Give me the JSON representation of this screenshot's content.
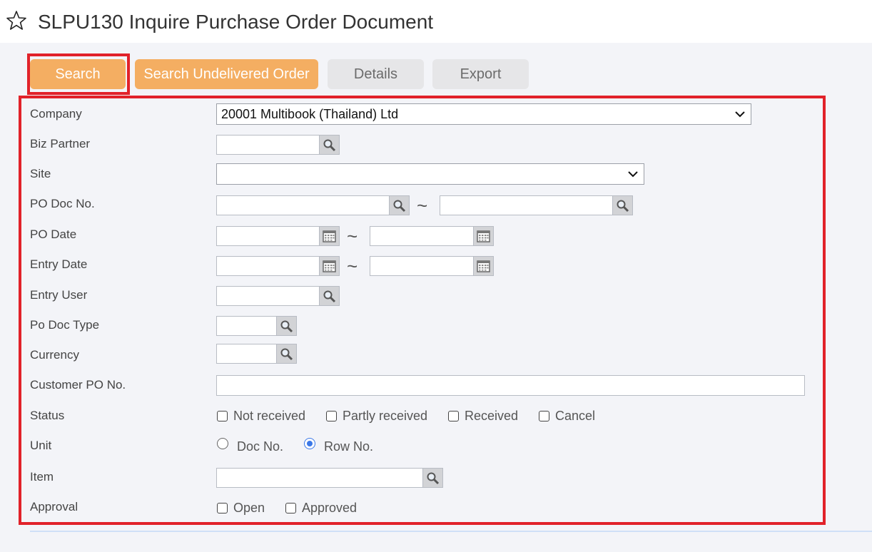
{
  "header": {
    "title": "SLPU130 Inquire Purchase Order Document",
    "favorite_icon": "star-outline-icon"
  },
  "toolbar": {
    "search_label": "Search",
    "search_undelivered_label": "Search Undelivered Order",
    "details_label": "Details",
    "export_label": "Export"
  },
  "form": {
    "company": {
      "label": "Company",
      "value": "20001 Multibook (Thailand) Ltd"
    },
    "biz_partner": {
      "label": "Biz Partner",
      "value": ""
    },
    "site": {
      "label": "Site",
      "value": ""
    },
    "po_doc_no": {
      "label": "PO Doc No.",
      "from": "",
      "to": "",
      "separator": "~"
    },
    "po_date": {
      "label": "PO Date",
      "from": "",
      "to": "",
      "separator": "~"
    },
    "entry_date": {
      "label": "Entry Date",
      "from": "",
      "to": "",
      "separator": "~"
    },
    "entry_user": {
      "label": "Entry User",
      "value": ""
    },
    "po_doc_type": {
      "label": "Po Doc Type",
      "value": ""
    },
    "currency": {
      "label": "Currency",
      "value": ""
    },
    "customer_po_no": {
      "label": "Customer PO No.",
      "value": ""
    },
    "status": {
      "label": "Status",
      "options": [
        {
          "label": "Not received",
          "checked": false
        },
        {
          "label": "Partly received",
          "checked": false
        },
        {
          "label": "Received",
          "checked": false
        },
        {
          "label": "Cancel",
          "checked": false
        }
      ]
    },
    "unit": {
      "label": "Unit",
      "options": [
        {
          "label": "Doc No.",
          "selected": false
        },
        {
          "label": "Row No.",
          "selected": true
        }
      ]
    },
    "item": {
      "label": "Item",
      "value": ""
    },
    "approval": {
      "label": "Approval",
      "options": [
        {
          "label": "Open",
          "checked": false
        },
        {
          "label": "Approved",
          "checked": false
        }
      ]
    }
  },
  "colors": {
    "accent": "#f4ae62",
    "highlight": "#e1222a",
    "radio_selected": "#3b78e7"
  }
}
